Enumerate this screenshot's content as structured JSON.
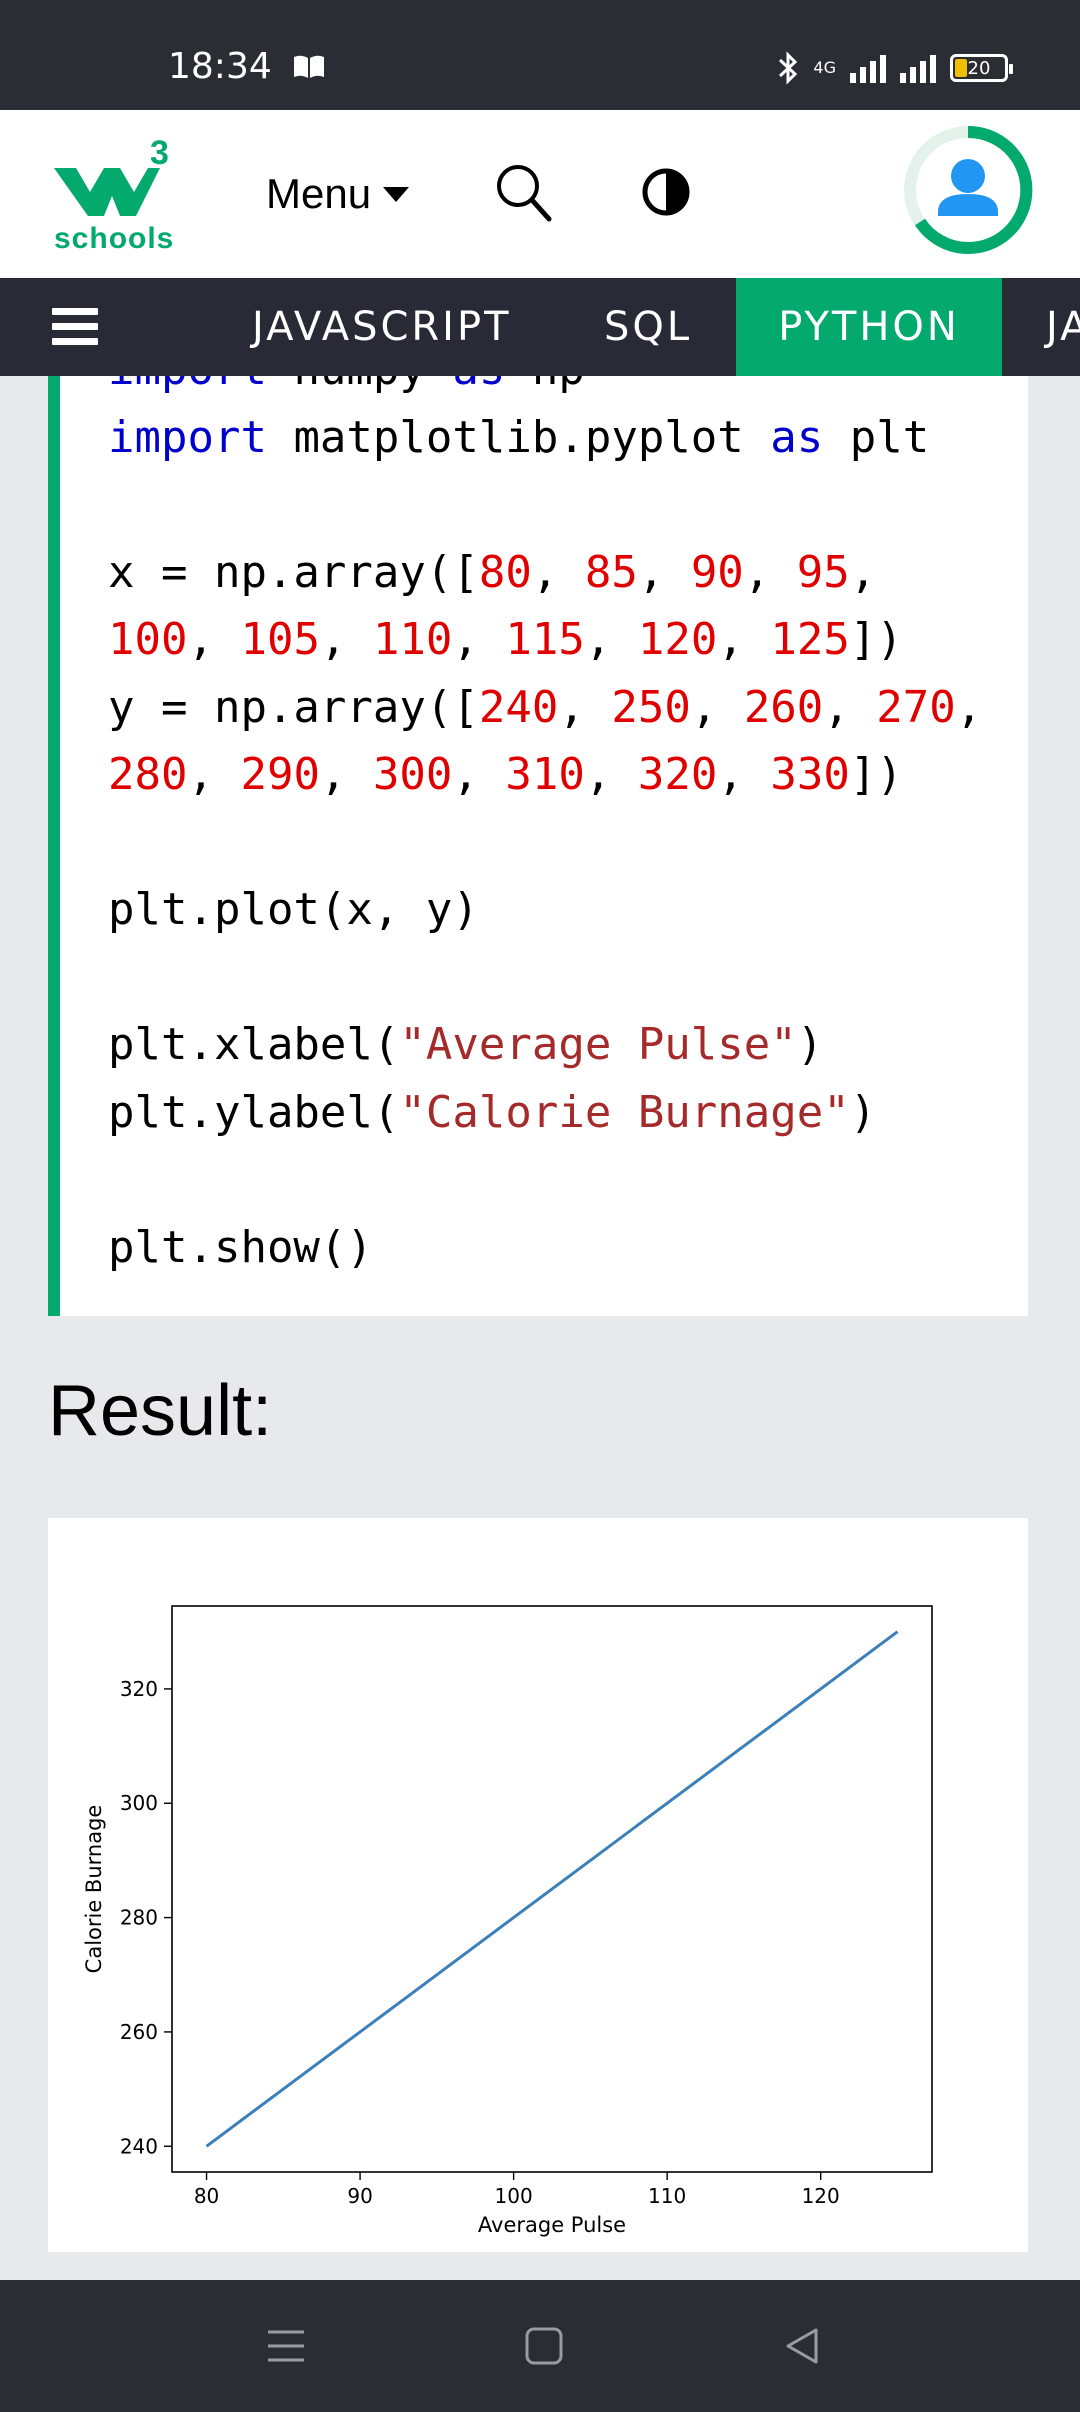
{
  "status_bar": {
    "time": "18:34",
    "network": "4G",
    "battery": "20",
    "icons": [
      "book-icon",
      "bluetooth-icon",
      "signal-icon",
      "battery-icon"
    ]
  },
  "header": {
    "logo_superscript": "3",
    "logo_text": "schools",
    "menu_label": "Menu",
    "icons": [
      "search-icon",
      "contrast-icon",
      "avatar-icon"
    ],
    "brand_color": "#04aa6d"
  },
  "nav": {
    "items": [
      {
        "label": "JAVASCRIPT",
        "active": false
      },
      {
        "label": "SQL",
        "active": false
      },
      {
        "label": "PYTHON",
        "active": true
      },
      {
        "label": "JA",
        "active": false
      }
    ],
    "active_color": "#04aa6d"
  },
  "code": {
    "lines": [
      "import numpy as np",
      "import matplotlib.pyplot as plt",
      "",
      "x = np.array([80, 85, 90, 95,",
      "100, 105, 110, 115, 120, 125])",
      "y = np.array([240, 250, 260, 270,",
      "280, 290, 300, 310, 320, 330])",
      "",
      "plt.plot(x, y)",
      "",
      "plt.xlabel(\"Average Pulse\")",
      "plt.ylabel(\"Calorie Burnage\")",
      "",
      "plt.show()"
    ],
    "colors": {
      "keyword": "#0000cd",
      "number": "#e00000",
      "string": "#a52a2a"
    }
  },
  "result_title": "Result:",
  "chart_data": {
    "type": "line",
    "x": [
      80,
      85,
      90,
      95,
      100,
      105,
      110,
      115,
      120,
      125
    ],
    "series": [
      {
        "values": [
          240,
          250,
          260,
          270,
          280,
          290,
          300,
          310,
          320,
          330
        ],
        "color": "#3b80b9"
      }
    ],
    "xlabel": "Average Pulse",
    "ylabel": "Calorie Burnage",
    "xticks": [
      80,
      90,
      100,
      110,
      120
    ],
    "yticks": [
      240,
      260,
      280,
      300,
      320
    ],
    "xlim": [
      77.75,
      127.25
    ],
    "ylim": [
      235.5,
      334.5
    ],
    "grid": false
  },
  "bottom_nav": {
    "icons": [
      "menu-icon",
      "home-icon",
      "back-icon"
    ]
  }
}
